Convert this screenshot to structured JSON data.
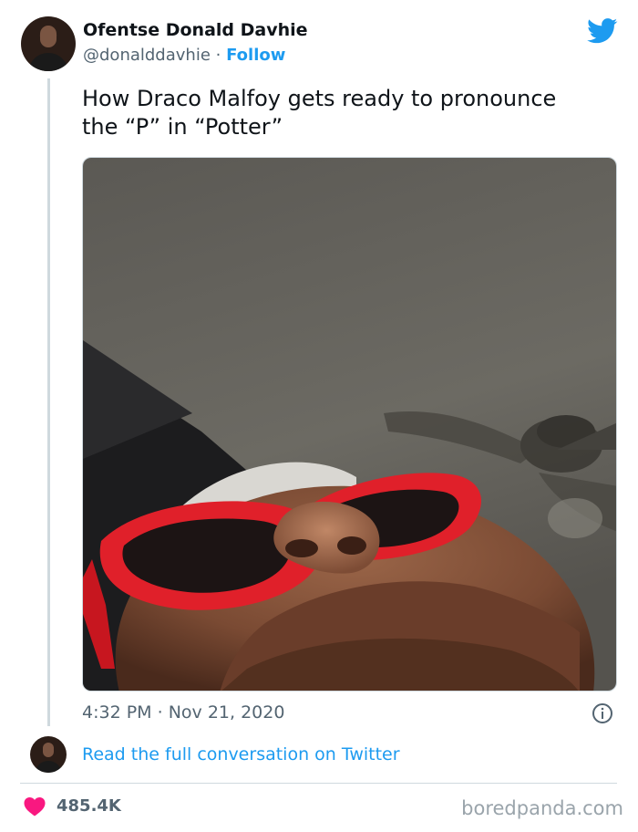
{
  "author": {
    "name": "Ofentse Donald Davhie",
    "handle": "@donalddavhie",
    "separator": "·",
    "follow_label": "Follow"
  },
  "tweet": {
    "line1": "How Draco Malfoy gets ready to pronounce",
    "line2": "the “P” in “Potter”",
    "time": "4:32 PM",
    "separator": "·",
    "date": "Nov 21, 2020"
  },
  "conversation_link": "Read the full conversation on Twitter",
  "likes": "485.4K",
  "source_watermark": "boredpanda.com",
  "colors": {
    "twitter_blue": "#1d9bf0",
    "heart": "#f91880",
    "sunglasses_red": "#e0202a"
  },
  "icons": {
    "brand": "twitter-bird-icon",
    "info": "info-icon",
    "like": "heart-icon"
  }
}
